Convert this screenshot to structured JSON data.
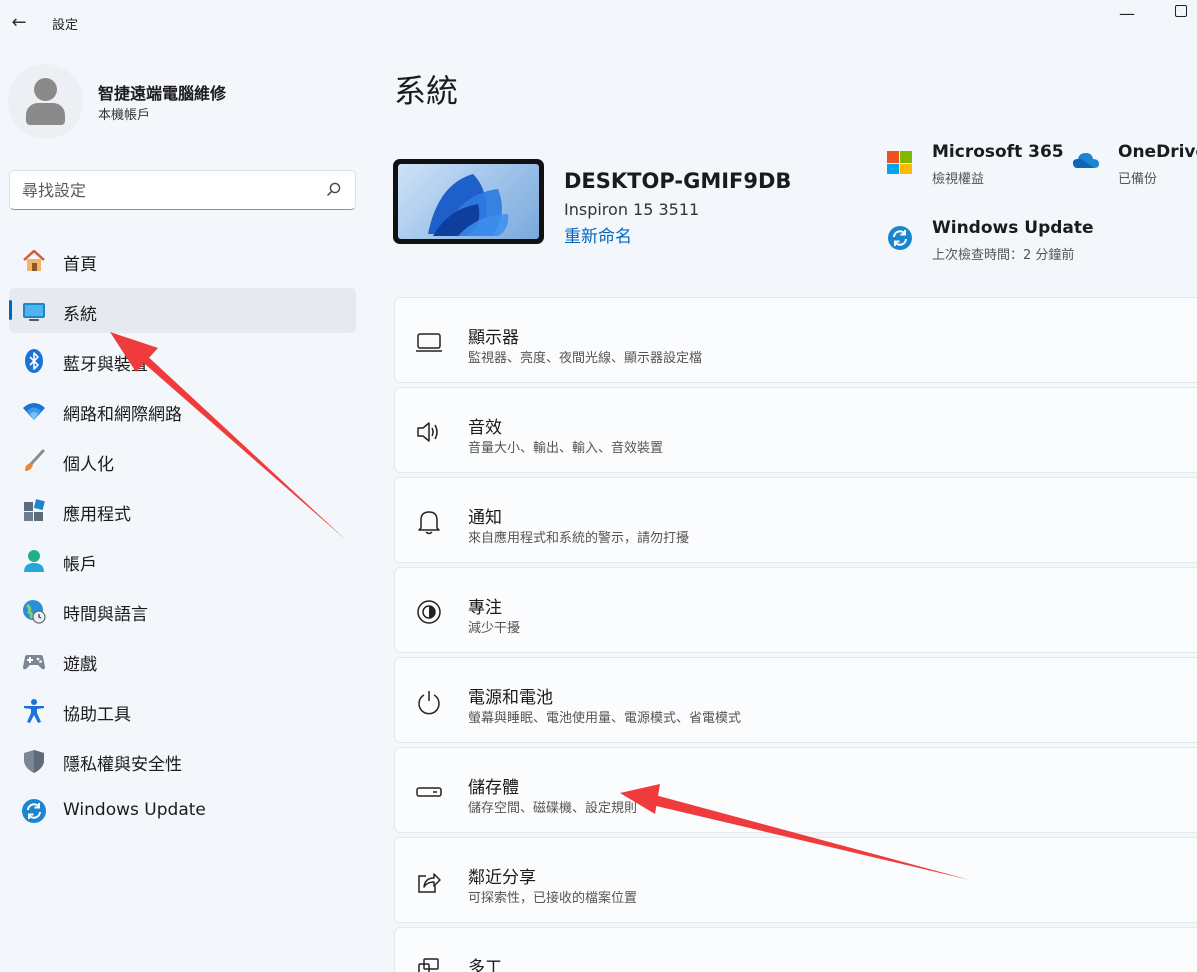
{
  "window": {
    "title": "設定",
    "back_glyph": "←",
    "minimize_glyph": "—"
  },
  "account": {
    "name": "智捷遠端電腦維修",
    "type": "本機帳戶"
  },
  "search": {
    "placeholder": "尋找設定"
  },
  "nav": {
    "items": [
      {
        "label": "首頁",
        "icon": "home-icon"
      },
      {
        "label": "系統",
        "icon": "system-icon",
        "active": true
      },
      {
        "label": "藍牙與裝置",
        "icon": "bluetooth-icon"
      },
      {
        "label": "網路和網際網路",
        "icon": "wifi-icon"
      },
      {
        "label": "個人化",
        "icon": "brush-icon"
      },
      {
        "label": "應用程式",
        "icon": "apps-icon"
      },
      {
        "label": "帳戶",
        "icon": "person-icon"
      },
      {
        "label": "時間與語言",
        "icon": "globe-clock-icon"
      },
      {
        "label": "遊戲",
        "icon": "gamepad-icon"
      },
      {
        "label": "協助工具",
        "icon": "accessibility-icon"
      },
      {
        "label": "隱私權與安全性",
        "icon": "shield-icon"
      },
      {
        "label": "Windows Update",
        "icon": "update-icon"
      }
    ]
  },
  "main": {
    "title": "系統",
    "device": {
      "name": "DESKTOP-GMIF9DB",
      "model": "Inspiron 15 3511",
      "rename_label": "重新命名"
    },
    "quick": {
      "m365_title": "Microsoft 365",
      "m365_sub": "檢視權益",
      "onedrive_title": "OneDrive",
      "onedrive_sub": "已備份",
      "wu_title": "Windows Update",
      "wu_sub": "上次檢查時間：2 分鐘前"
    },
    "cards": [
      {
        "title": "顯示器",
        "sub": "監視器、亮度、夜間光線、顯示器設定檔",
        "icon": "monitor-icon"
      },
      {
        "title": "音效",
        "sub": "音量大小、輸出、輸入、音效裝置",
        "icon": "speaker-icon"
      },
      {
        "title": "通知",
        "sub": "來自應用程式和系統的警示，請勿打擾",
        "icon": "bell-icon"
      },
      {
        "title": "專注",
        "sub": "減少干擾",
        "icon": "focus-icon"
      },
      {
        "title": "電源和電池",
        "sub": "螢幕與睡眠、電池使用量、電源模式、省電模式",
        "icon": "power-icon"
      },
      {
        "title": "儲存體",
        "sub": "儲存空間、磁碟機、設定規則",
        "icon": "storage-icon"
      },
      {
        "title": "鄰近分享",
        "sub": "可探索性，已接收的檔案位置",
        "icon": "share-icon"
      },
      {
        "title": "多工",
        "sub": "",
        "icon": "multitask-icon"
      }
    ]
  },
  "colors": {
    "accent": "#0067c0",
    "annotation_arrow": "#ef3b3b"
  }
}
